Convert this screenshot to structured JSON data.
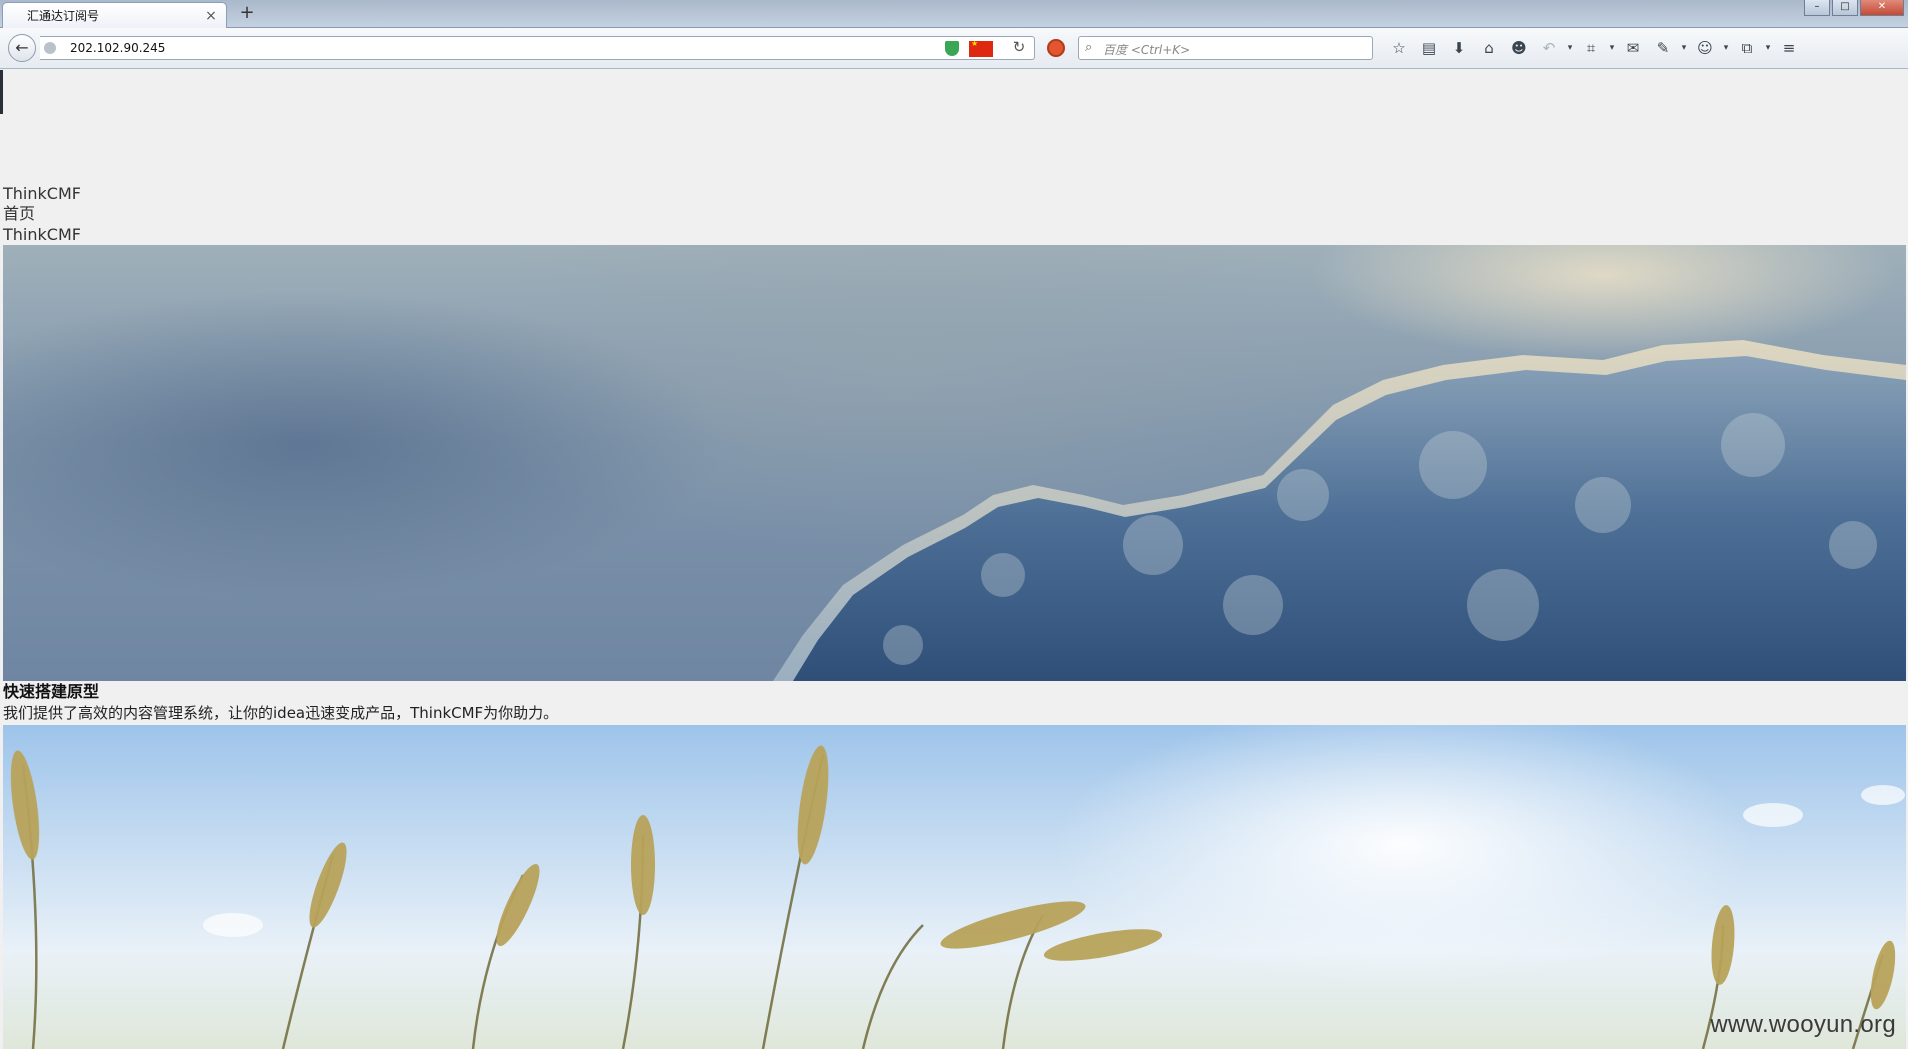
{
  "window": {
    "tab_title": "汇通达订阅号",
    "tab_close": "×",
    "new_tab": "+",
    "controls": {
      "minimize": "–",
      "maximize": "□",
      "close": "✕"
    }
  },
  "navbar": {
    "back": "←",
    "url": "202.102.90.245",
    "reload": "↻",
    "search_placeholder": "百度 <Ctrl+K>",
    "search_icon": "⌕",
    "toolbar": {
      "bookmark_star": "☆",
      "bookmarks_list": "▤",
      "downloads": "⬇",
      "home": "⌂",
      "chat": "☻",
      "undo": "↶",
      "screenshot": "⌗",
      "comment": "✉",
      "feed": "✎",
      "monkey": "☺",
      "sync": "⧉",
      "menu": "≡",
      "dropdown": "▾"
    }
  },
  "page": {
    "site_name": "ThinkCMF",
    "nav_home": "首页",
    "nav_brand": "ThinkCMF",
    "headline": "快速搭建原型",
    "subline": "我们提供了高效的内容管理系统，让你的idea迅速变成产品，ThinkCMF为你助力。",
    "watermark": "www.wooyun.org"
  },
  "colors": {
    "page_bg": "#f0f0f0",
    "tab_bar": "#c4d1e0",
    "flag_red": "#de2910",
    "shield_green": "#3aa757"
  }
}
